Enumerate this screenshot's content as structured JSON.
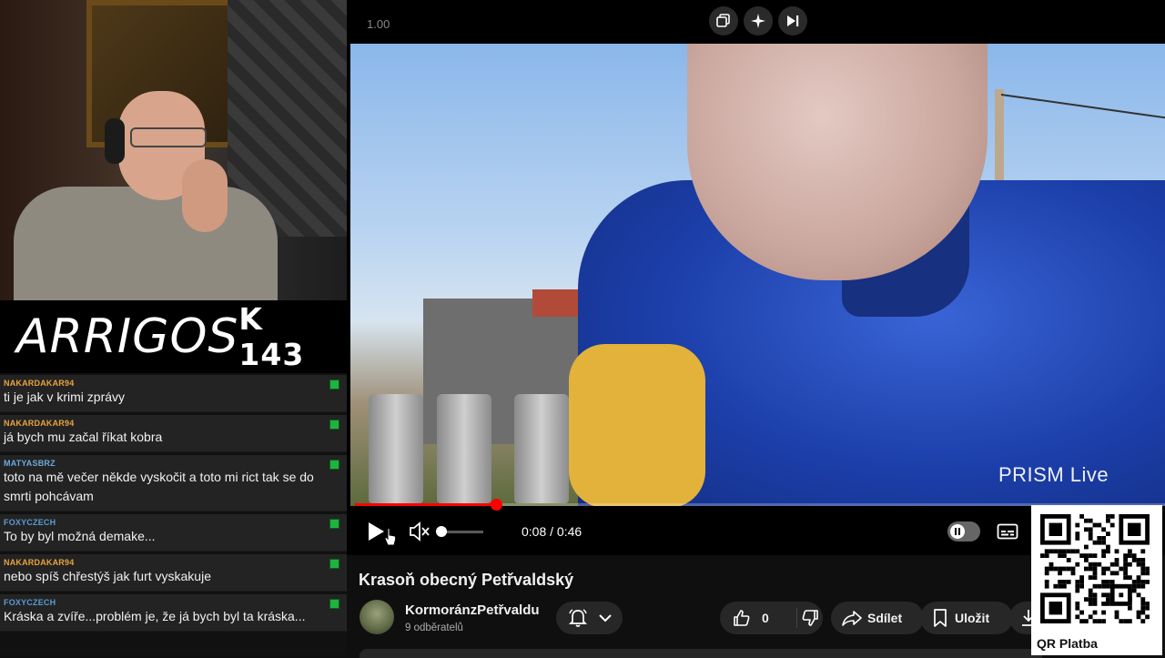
{
  "stream": {
    "logo": "ARRIGOS",
    "code": "K 143"
  },
  "chat": {
    "messages": [
      {
        "user": "NAKARDAKAR94",
        "color": "#e8a33d",
        "text": "ti je jak v krimi zprávy"
      },
      {
        "user": "NAKARDAKAR94",
        "color": "#e8a33d",
        "text": "já bych mu začal říkat kobra"
      },
      {
        "user": "MATYASBRZ",
        "color": "#6fa8dc",
        "text": "toto na mě večer někde vyskočit a toto mi rict tak se do smrti pohcávam"
      },
      {
        "user": "FOXYCZECH",
        "color": "#5b9bd5",
        "text": "To by byl možná demake..."
      },
      {
        "user": "NAKARDAKAR94",
        "color": "#e8a33d",
        "text": "nebo spíš chřestýš jak furt vyskakuje"
      },
      {
        "user": "FOXYCZECH",
        "color": "#5b9bd5",
        "text": "Kráska a zvíře...problém je, že já bych byl ta kráska..."
      }
    ]
  },
  "player": {
    "speed": "1.00",
    "current_time": "0:08",
    "duration": "0:46",
    "time_display": "0:08 / 0:46",
    "progress_fraction": 0.174,
    "volume_fraction": 0.0,
    "watermark": "PRISM Live",
    "icons": [
      "copy-icon",
      "sparkle-icon",
      "skip-next-icon",
      "play-icon",
      "mute-icon",
      "autoplay-pause-icon",
      "captions-icon"
    ],
    "accent": "#ff0000"
  },
  "video": {
    "title": "Krasoň obecný Petřvaldský",
    "channel": "KormoránzPetřvaldu",
    "subscribers": "9 odběratelů",
    "likes": "0",
    "share_label": "Sdílet",
    "save_label": "Uložit"
  },
  "qr": {
    "label": "QR Platba"
  }
}
